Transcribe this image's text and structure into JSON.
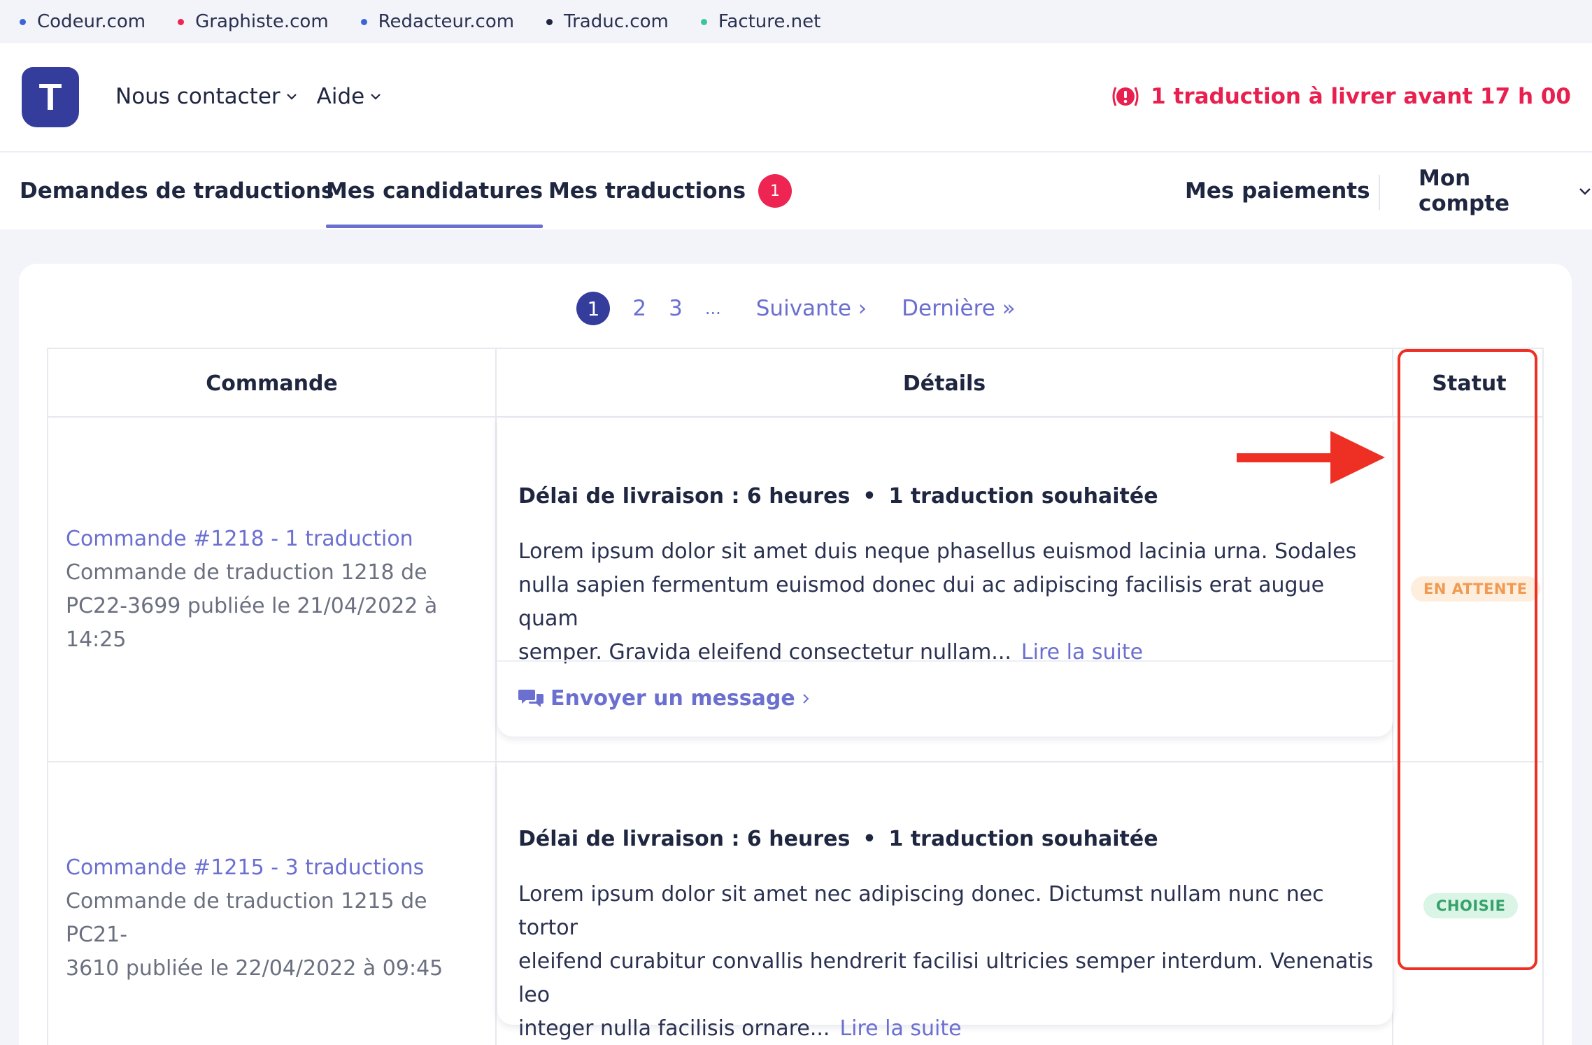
{
  "network": [
    {
      "label": "Codeur.com",
      "color": "#3b64d6"
    },
    {
      "label": "Graphiste.com",
      "color": "#ee2452"
    },
    {
      "label": "Redacteur.com",
      "color": "#3b64d6"
    },
    {
      "label": "Traduc.com",
      "color": "#1f2640"
    },
    {
      "label": "Facture.net",
      "color": "#3cc49a"
    }
  ],
  "header": {
    "logo_letter": "T",
    "menu": [
      {
        "label": "Nous contacter"
      },
      {
        "label": "Aide"
      }
    ],
    "alert_text": "1 traduction à livrer avant 17 h 00"
  },
  "nav": {
    "tabs": [
      {
        "label": "Demandes de traductions"
      },
      {
        "label": "Mes candidatures"
      },
      {
        "label": "Mes traductions",
        "badge": "1"
      }
    ],
    "right": [
      {
        "label": "Mes paiements"
      },
      {
        "label": "Mon compte"
      }
    ]
  },
  "pagination": {
    "current": "1",
    "pages": [
      "2",
      "3",
      "..."
    ],
    "next": "Suivante ›",
    "last": "Dernière »"
  },
  "table": {
    "headers": [
      "Commande",
      "Détails",
      "Statut"
    ],
    "rows": [
      {
        "title": "Commande #1218 - 1 traduction",
        "desc_lines": [
          "Commande de traduction 1218 de",
          "PC22-3699 publiée le 21/04/2022 à",
          "14:25"
        ],
        "delay": "Délai de livraison : 6 heures",
        "count": "1 traduction souhaitée",
        "text_lines": [
          "Lorem ipsum dolor sit amet duis neque phasellus euismod lacinia urna. Sodales",
          "nulla sapien fermentum euismod donec dui ac adipiscing facilisis erat augue quam",
          "semper. Gravida eleifend consectetur nullam..."
        ],
        "read_more": "Lire la suite",
        "message": "Envoyer un message",
        "status": "EN ATTENTE"
      },
      {
        "title": "Commande #1215 - 3 traductions",
        "desc_lines": [
          "Commande de traduction 1215 de PC21-",
          "3610 publiée le 22/04/2022 à 09:45"
        ],
        "delay": "Délai de livraison : 6 heures",
        "count": "1 traduction souhaitée",
        "text_lines": [
          "Lorem ipsum dolor sit amet nec adipiscing donec. Dictumst nullam nunc nec tortor",
          "eleifend curabitur convallis hendrerit facilisi ultricies semper interdum. Venenatis leo",
          "integer nulla facilisis ornare..."
        ],
        "read_more": "Lire la suite",
        "status": "CHOISIE"
      }
    ]
  },
  "colors": {
    "brand": "#343c9c",
    "accent": "#6b6fd0",
    "alert": "#e8204f",
    "annotation": "#ee2f24"
  }
}
